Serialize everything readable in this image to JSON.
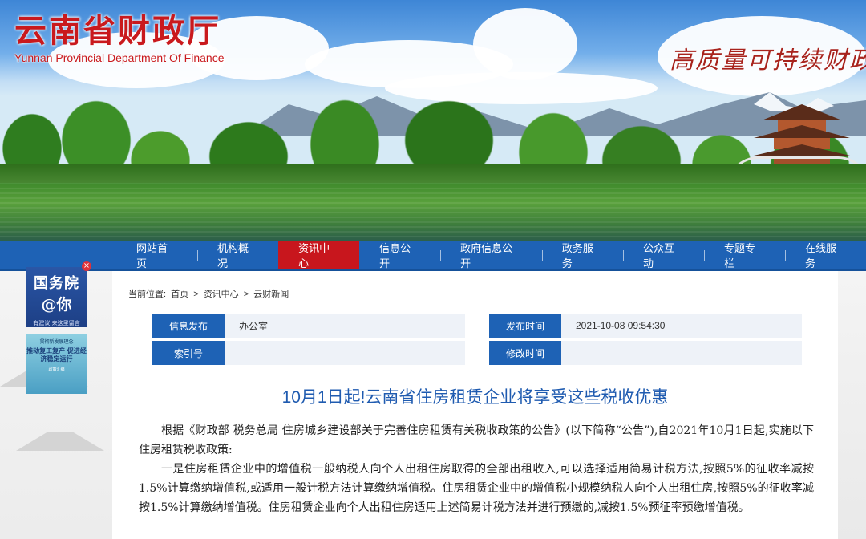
{
  "header": {
    "site_title": "云南省财政厅",
    "site_subtitle": "Yunnan Provincial Department Of Finance",
    "slogan": "高质量可持续财政"
  },
  "nav": {
    "items": [
      {
        "label": "网站首页"
      },
      {
        "label": "机构概况"
      },
      {
        "label": "资讯中心",
        "active": true
      },
      {
        "label": "信息公开"
      },
      {
        "label": "政府信息公开"
      },
      {
        "label": "政务服务"
      },
      {
        "label": "公众互动"
      },
      {
        "label": "专题专栏"
      },
      {
        "label": "在线服务"
      }
    ],
    "colors": {
      "bar": "#1e62b5",
      "active": "#c8161d"
    }
  },
  "breadcrumb": {
    "prefix": "当前位置:",
    "items": [
      "首页",
      "资讯中心",
      "云财新闻"
    ],
    "separator": ">"
  },
  "meta": {
    "publisher_label": "信息发布",
    "publisher_value": "办公室",
    "publish_time_label": "发布时间",
    "publish_time_value": "2021-10-08 09:54:30",
    "index_label": "索引号",
    "index_value": "",
    "modified_label": "修改时间",
    "modified_value": ""
  },
  "float_ads": {
    "ad1": {
      "line1": "国务院",
      "line2": "@你",
      "line3": "有建议  来这里留言",
      "close": "×"
    },
    "ad2": {
      "t1": "贯彻新发展理念",
      "t2": "推动复工复产 促进经济稳定运行",
      "t3": "政策汇编"
    }
  },
  "article": {
    "title": "10月1日起!云南省住房租赁企业将享受这些税收优惠",
    "paragraphs": [
      "根据《财政部 税务总局 住房城乡建设部关于完善住房租赁有关税收政策的公告》(以下简称“公告”),自2021年10月1日起,实施以下住房租赁税收政策:",
      "一是住房租赁企业中的增值税一般纳税人向个人出租住房取得的全部出租收入,可以选择适用简易计税方法,按照5%的征收率减按1.5%计算缴纳增值税,或适用一般计税方法计算缴纳增值税。住房租赁企业中的增值税小规模纳税人向个人出租住房,按照5%的征收率减按1.5%计算缴纳增值税。住房租赁企业向个人出租住房适用上述简易计税方法并进行预缴的,减按1.5%预征率预缴增值税。"
    ]
  }
}
